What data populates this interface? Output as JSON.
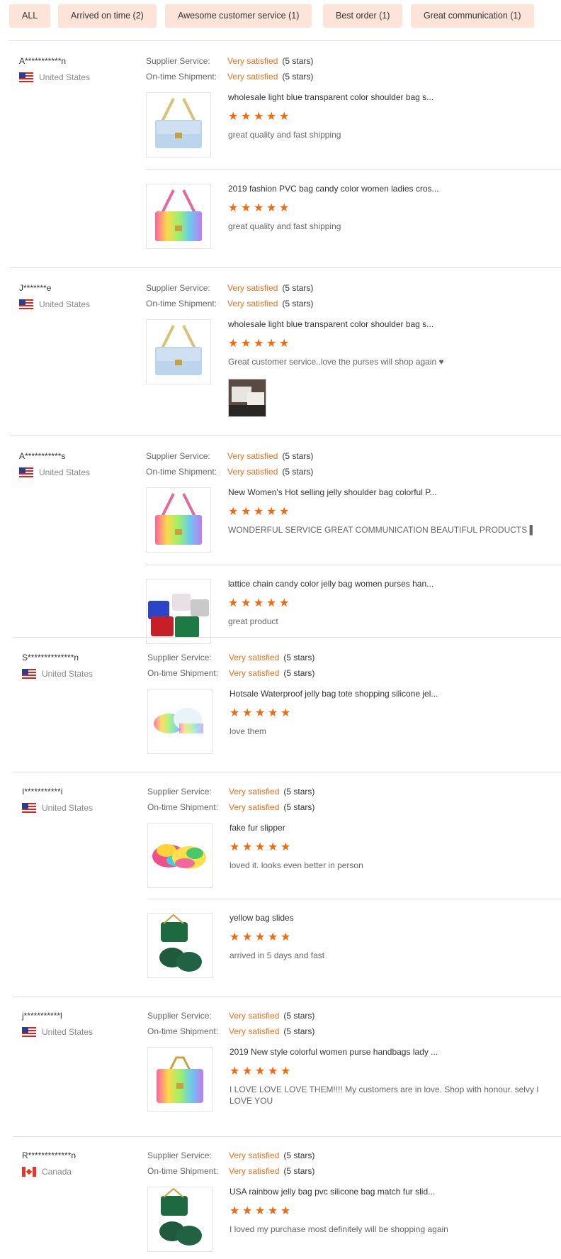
{
  "filters": [
    {
      "label": "ALL"
    },
    {
      "label": "Arrived on time (2)"
    },
    {
      "label": "Awesome customer service (1)"
    },
    {
      "label": "Best order (1)"
    },
    {
      "label": "Great communication (1)"
    }
  ],
  "labels": {
    "supplier": "Supplier Service:",
    "shipment": "On-time Shipment:"
  },
  "colors": {
    "accent": "#e8701a",
    "star": "#f06a10",
    "chip_bg": "#fde4d8"
  },
  "reviews": [
    {
      "buyer": "A***********n",
      "country": "United States",
      "flag": "us-flag-icon",
      "supplier_value": "Very satisfied",
      "supplier_stars": "(5 stars)",
      "shipment_value": "Very satisfied",
      "shipment_stars": "(5 stars)",
      "products": [
        {
          "title": "wholesale light blue transparent color shoulder bag s...",
          "stars": 5,
          "comment": "great quality and fast shipping",
          "image": "blue-bag"
        },
        {
          "title": "2019 fashion PVC bag candy color women ladies cros...",
          "stars": 5,
          "comment": "great quality and fast shipping",
          "image": "rainbow-bag"
        }
      ]
    },
    {
      "buyer": "J*******e",
      "country": "United States",
      "flag": "us-flag-icon",
      "supplier_value": "Very satisfied",
      "supplier_stars": "(5 stars)",
      "shipment_value": "Very satisfied",
      "shipment_stars": "(5 stars)",
      "products": [
        {
          "title": "wholesale light blue transparent color shoulder bag s...",
          "stars": 5,
          "comment": "Great customer service..love the purses will shop again ♥",
          "image": "blue-bag",
          "photo": "bags-in-box"
        }
      ]
    },
    {
      "buyer": "A***********s",
      "country": "United States",
      "flag": "us-flag-icon",
      "supplier_value": "Very satisfied",
      "supplier_stars": "(5 stars)",
      "shipment_value": "Very satisfied",
      "shipment_stars": "(5 stars)",
      "products": [
        {
          "title": "New Women's Hot selling jelly shoulder bag colorful P...",
          "stars": 5,
          "comment": "WONDERFUL SERVICE GREAT COMMUNICATION BEAUTIFUL PRODUCTS ▌",
          "image": "rainbow-bag"
        },
        {
          "title": "lattice chain candy color jelly bag women purses han...",
          "stars": 5,
          "comment": "great product",
          "image": "multi-bags"
        }
      ]
    },
    {
      "buyer": "S**************n",
      "country": "United States",
      "flag": "us-flag-icon",
      "supplier_value": "Very satisfied",
      "supplier_stars": "(5 stars)",
      "shipment_value": "Very satisfied",
      "shipment_stars": "(5 stars)",
      "products": [
        {
          "title": "Hotsale Waterproof jelly bag tote shopping silicone jel...",
          "stars": 5,
          "comment": "love them",
          "image": "tote-bags"
        }
      ]
    },
    {
      "buyer": "I***********i",
      "country": "United States",
      "flag": "us-flag-icon",
      "supplier_value": "Very satisfied",
      "supplier_stars": "(5 stars)",
      "shipment_value": "Very satisfied",
      "shipment_stars": "(5 stars)",
      "products": [
        {
          "title": "fake fur slipper",
          "stars": 5,
          "comment": "loved it. looks even better in person",
          "image": "fur-slipper"
        },
        {
          "title": "yellow bag slides",
          "stars": 5,
          "comment": "arrived in 5 days and fast",
          "image": "green-set"
        }
      ]
    },
    {
      "buyer": "j***********l",
      "country": "United States",
      "flag": "us-flag-icon",
      "supplier_value": "Very satisfied",
      "supplier_stars": "(5 stars)",
      "shipment_value": "Very satisfied",
      "shipment_stars": "(5 stars)",
      "products": [
        {
          "title": "2019 New style colorful women purse handbags lady ...",
          "stars": 5,
          "comment": "I LOVE LOVE LOVE THEM!!!! My customers are in love. Shop with honour. selvy I LOVE YOU",
          "image": "pink-bag"
        }
      ]
    },
    {
      "buyer": "R*************n",
      "country": "Canada",
      "flag": "canada-flag-icon",
      "supplier_value": "Very satisfied",
      "supplier_stars": "(5 stars)",
      "shipment_value": "Very satisfied",
      "shipment_stars": "(5 stars)",
      "products": [
        {
          "title": "USA rainbow jelly bag pvc silicone bag match fur slid...",
          "stars": 5,
          "comment": "I loved my purchase most definitely will be shopping again",
          "image": "green-set"
        }
      ]
    }
  ]
}
